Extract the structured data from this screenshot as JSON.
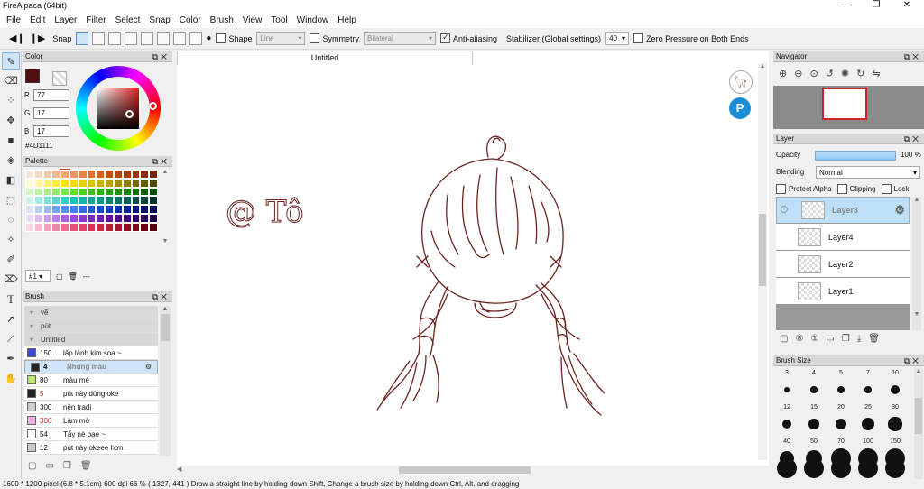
{
  "window": {
    "title": "FireAlpaca (64bit)",
    "min_glyph": "—",
    "max_glyph": "❐",
    "close_glyph": "✕"
  },
  "menu": [
    "File",
    "Edit",
    "Layer",
    "Filter",
    "Select",
    "Snap",
    "Color",
    "Brush",
    "View",
    "Tool",
    "Window",
    "Help"
  ],
  "toolbar": {
    "snap_label": "Snap",
    "shape_label": "Shape",
    "shape_value": "Line",
    "symmetry_label": "Symmetry",
    "symmetry_value": "Bilateral",
    "antialias_label": "Anti-aliasing",
    "stabilizer_label": "Stabilizer (Global settings)",
    "stabilizer_value": "40",
    "zero_pressure_label": "Zero Pressure on Both Ends"
  },
  "color_panel": {
    "title": "Color",
    "r_label": "R",
    "g_label": "G",
    "b_label": "B",
    "r": "77",
    "g": "17",
    "b": "17",
    "hex": "#4D1111",
    "current_color": "#4D1111"
  },
  "palette_panel": {
    "title": "Palette",
    "selector": "#1",
    "more": "---",
    "swatches": [
      "#f5e6d8",
      "#f4d9c4",
      "#f5c8a8",
      "#f3b98e",
      "#f1a877",
      "#ee9560",
      "#ea8448",
      "#e07030",
      "#d35f1f",
      "#c4500f",
      "#b84408",
      "#a83d0a",
      "#973510",
      "#852d10",
      "#742610",
      "#fffbd0",
      "#fff7a0",
      "#fff170",
      "#ffeb40",
      "#ffe400",
      "#f4dc00",
      "#e8d000",
      "#dcc400",
      "#c8b400",
      "#b4a200",
      "#a09000",
      "#8c7e00",
      "#786c00",
      "#645a00",
      "#504800",
      "#d6f5c8",
      "#c0f0a8",
      "#a8ec88",
      "#90e868",
      "#78e448",
      "#60dc30",
      "#48d020",
      "#3cc018",
      "#30b010",
      "#28a00c",
      "#209008",
      "#188006",
      "#107004",
      "#086002",
      "#005000",
      "#d0f0ee",
      "#a8e8e4",
      "#80e0da",
      "#58d8d0",
      "#30d0c6",
      "#18c4ba",
      "#10b4aa",
      "#08a49a",
      "#04948a",
      "#00847a",
      "#00746a",
      "#00645a",
      "#00544a",
      "#00443a",
      "#00342a",
      "#d8e4fb",
      "#b8cff8",
      "#98baf5",
      "#78a5f2",
      "#5890ef",
      "#407cea",
      "#2e6ae0",
      "#2258d4",
      "#1848c6",
      "#1038b8",
      "#0a2ca6",
      "#062292",
      "#04187e",
      "#02106a",
      "#000858",
      "#ecd8f8",
      "#dcbaf4",
      "#cc9cf0",
      "#bc7eec",
      "#ac60e8",
      "#9c48e0",
      "#8c36d4",
      "#7c28c4",
      "#6c1cb4",
      "#5c12a2",
      "#4e0a90",
      "#40067e",
      "#32026c",
      "#26005a",
      "#1a0048",
      "#fbd8e4",
      "#f8bccf",
      "#f5a0ba",
      "#f284a5",
      "#ef6890",
      "#ea507c",
      "#e0406a",
      "#d43458",
      "#c62848",
      "#b81e3a",
      "#a6162e",
      "#921024",
      "#7e0a1a",
      "#6a0612",
      "#56020a"
    ]
  },
  "brush_panel": {
    "title": "Brush",
    "rows": [
      {
        "type": "group",
        "name": "vẽ"
      },
      {
        "type": "group",
        "name": "pút"
      },
      {
        "type": "group",
        "name": "Untitled"
      },
      {
        "type": "item",
        "size": "150",
        "name": "lấp lánh kim soa ~",
        "color": "#3a4ad8",
        "size_color": "#111"
      },
      {
        "type": "item",
        "size": "4",
        "name": "Nhúng màu",
        "color": "#222222",
        "size_color": "#111",
        "selected": true
      },
      {
        "type": "item",
        "size": "80",
        "name": "màu mè",
        "color": "#b8e870",
        "size_color": "#111"
      },
      {
        "type": "item",
        "size": "5",
        "name": "pút này dùng oke",
        "color": "#222222",
        "size_color": "#d02020"
      },
      {
        "type": "item",
        "size": "300",
        "name": "nền tradi",
        "color": "#cccccc",
        "size_color": "#111"
      },
      {
        "type": "item",
        "size": "300",
        "name": "Làm mờ",
        "color": "#f0b0e8",
        "size_color": "#d02020"
      },
      {
        "type": "item",
        "size": "54",
        "name": "Tẩy nè bae ~",
        "color": "#ffffff",
        "size_color": "#111"
      },
      {
        "type": "item",
        "size": "12",
        "name": "pút này okeee hơn",
        "color": "#cccccc",
        "size_color": "#111"
      }
    ]
  },
  "document": {
    "tab": "Untitled",
    "annotation": "@ Tô"
  },
  "navigator_panel": {
    "title": "Navigator"
  },
  "layer_panel": {
    "title": "Layer",
    "opacity_label": "Opacity",
    "opacity_value": "100 %",
    "opacity": 1.0,
    "blending_label": "Blending",
    "blending_value": "Normal",
    "protect_alpha": "Protect Alpha",
    "clipping": "Clipping",
    "lock": "Lock",
    "layers": [
      {
        "name": "Layer3",
        "selected": true
      },
      {
        "name": "Layer4",
        "selected": false
      },
      {
        "name": "Layer2",
        "selected": false
      },
      {
        "name": "Layer1",
        "selected": false
      }
    ]
  },
  "brush_size_panel": {
    "title": "Brush Size",
    "sizes": [
      "3",
      "4",
      "5",
      "7",
      "10",
      "12",
      "15",
      "20",
      "25",
      "30",
      "40",
      "50",
      "70",
      "100",
      "150"
    ]
  },
  "status": {
    "text": "1600 * 1200 pixel  (6.8 * 5.1cm)  600 dpi  66 %  ( 1327, 441 )  Draw a straight line by holding down Shift, Change a brush size by holding down Ctrl, Alt, and dragging"
  },
  "colors": {
    "stroke": "#6b2320",
    "accent_selection": "#bde0f8",
    "nav_frame": "#d0202a"
  }
}
